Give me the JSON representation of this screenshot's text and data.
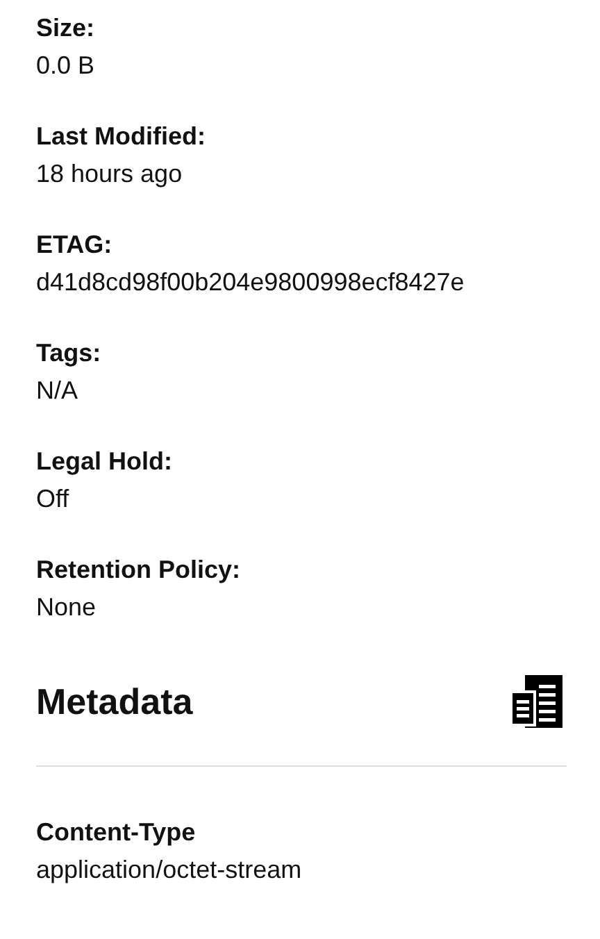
{
  "properties": [
    {
      "label": "Size:",
      "value": "0.0 B"
    },
    {
      "label": "Last Modified:",
      "value": "18 hours ago"
    },
    {
      "label": "ETAG:",
      "value": "d41d8cd98f00b204e9800998ecf8427e"
    },
    {
      "label": "Tags:",
      "value": "N/A"
    },
    {
      "label": "Legal Hold:",
      "value": "Off"
    },
    {
      "label": "Retention Policy:",
      "value": "None"
    }
  ],
  "metadata": {
    "title": "Metadata",
    "items": [
      {
        "label": "Content-Type",
        "value": "application/octet-stream"
      }
    ]
  }
}
